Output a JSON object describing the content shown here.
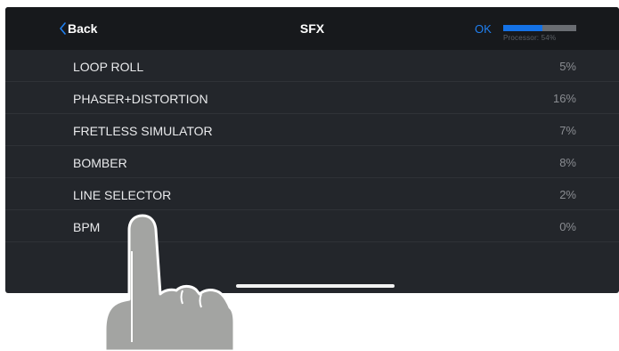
{
  "navbar": {
    "back_label": "Back",
    "title": "SFX",
    "ok_label": "OK",
    "processor_label": "Processor: 54%",
    "processor_level": 0.54
  },
  "effects": [
    {
      "name": "LOOP ROLL",
      "value": "5%"
    },
    {
      "name": "PHASER+DISTORTION",
      "value": "16%"
    },
    {
      "name": "FRETLESS SIMULATOR",
      "value": "7%"
    },
    {
      "name": "BOMBER",
      "value": "8%"
    },
    {
      "name": "LINE SELECTOR",
      "value": "2%"
    },
    {
      "name": "BPM",
      "value": "0%"
    }
  ],
  "colors": {
    "accent": "#1f7ff0",
    "background": "#23262b",
    "navbar": "#17191c",
    "hand": "#a3a4a2"
  },
  "icons": {
    "back": "chevron-left-icon",
    "overlay": "pointing-hand-icon"
  }
}
